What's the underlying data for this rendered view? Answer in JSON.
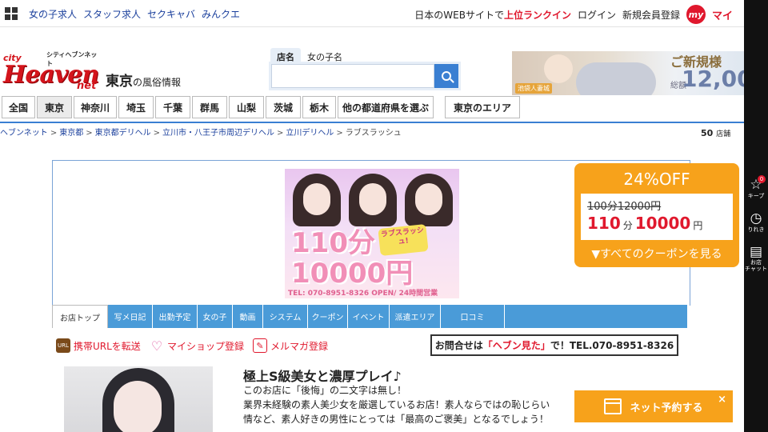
{
  "topbar": {
    "links": [
      "女の子求人",
      "スタッフ求人",
      "セクキャバ",
      "みんクエ"
    ],
    "rank_prefix": "日本のWEBサイトで",
    "rank_highlight": "上位ランクイン",
    "login": "ログイン",
    "register": "新規会員登録",
    "my_badge": "my",
    "my_text": "マイ"
  },
  "rail": {
    "keep": "キープ",
    "keep_count": "0",
    "history": "りれき",
    "chat": "お店\nチャット"
  },
  "header": {
    "logo_small": "シティヘブンネット",
    "logo_city": "city",
    "logo_main": "Heaven",
    "logo_net": "net",
    "area": "東京",
    "area_suffix": "の風俗情報",
    "search_tabs": [
      "店名",
      "女の子名"
    ],
    "search_placeholder": "",
    "promo": {
      "shop": "池袋人妻城",
      "t1": "ご新規様",
      "t2": "総額",
      "t3": "12,00"
    }
  },
  "prefs": [
    "全国",
    "東京",
    "神奈川",
    "埼玉",
    "千葉",
    "群馬",
    "山梨",
    "茨城",
    "栃木",
    "他の都道府県を選ぶ",
    "東京のエリア"
  ],
  "breadcrumb": [
    "ヘブンネット",
    "東京都",
    "東京都デリヘル",
    "立川市・八王子市周辺デリヘル",
    "立川デリヘル",
    "ラブスラッシュ"
  ],
  "count": {
    "num": "50",
    "unit": "店舗"
  },
  "shop_banner": {
    "big_line1": "110分",
    "big_line2": "10000円",
    "tag": "ラブスラッシュ!",
    "tel": "TEL: 070-8951-8326  OPEN/ 24時間営業"
  },
  "coupon": {
    "percent": "24%OFF",
    "old": "100分12000円",
    "new_min": "110",
    "new_min_unit": "分",
    "new_price": "10000",
    "new_price_unit": "円",
    "all": "▼すべてのクーポンを見る"
  },
  "shop_tabs": [
    "お店トップ",
    "写メ日記",
    "出勤予定",
    "女の子",
    "動画",
    "システム",
    "クーポン",
    "イベント",
    "派遣エリア",
    "口コミ"
  ],
  "actions": {
    "url": "携帯URLを転送",
    "myshop": "マイショップ登録",
    "mail": "メルマガ登録"
  },
  "inquiry": {
    "prefix": "お問合せは",
    "highlight": "「ヘブン見た」",
    "suffix": "で！TEL.070-8951-8326"
  },
  "content": {
    "title": "極上S級美女と濃厚プレイ♪",
    "lines": [
      "このお店に「後悔」の二文字は無し！",
      "業界未経験の素人美少女を厳選しているお店！素人ならではの恥じらい",
      "情など、素人好きの男性にとっては「最高のご褒美」となるでしょう！"
    ]
  },
  "reserve": {
    "label": "ネット予約する",
    "close": "×"
  }
}
